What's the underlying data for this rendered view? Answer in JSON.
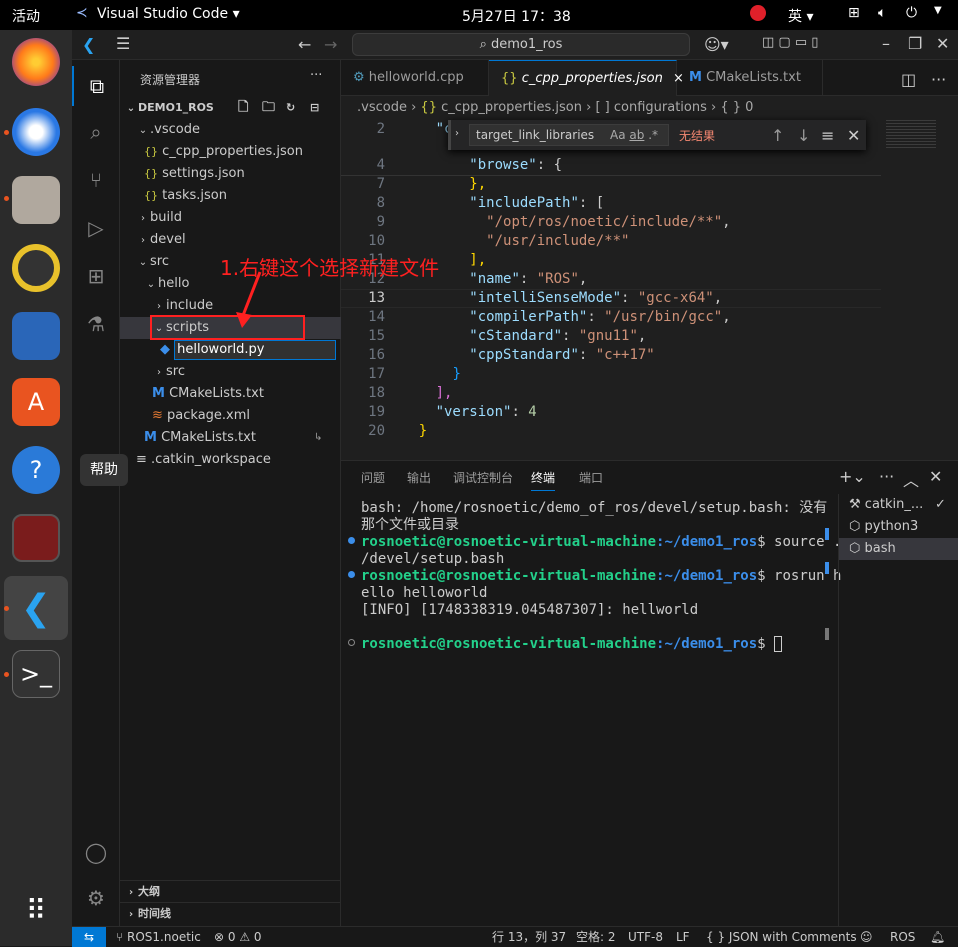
{
  "topbar": {
    "activities": "活动",
    "app_name": "Visual Studio Code",
    "clock": "5月27日  17：38",
    "lang": "英"
  },
  "title": {
    "search": "demo1_ros"
  },
  "dock": {
    "tooltip": "帮助"
  },
  "explorer": {
    "header": "资源管理器",
    "root": "DEMO1_ROS",
    "items": [
      ".vscode",
      "c_cpp_properties.json",
      "settings.json",
      "tasks.json",
      "build",
      "devel",
      "src",
      "hello",
      "include",
      "scripts",
      "helloworld.py",
      "src",
      "CMakeLists.txt",
      "package.xml",
      "CMakeLists.txt",
      ".catkin_workspace"
    ],
    "outline": "大纲",
    "timeline": "时间线"
  },
  "annotation": {
    "text": "1.右键这个选择新建文件",
    "color": "#ff2020"
  },
  "tabs": [
    "helloworld.cpp",
    "c_cpp_properties.json",
    "CMakeLists.txt"
  ],
  "breadcrumb": {
    "p1": ".vscode",
    "p2": "c_cpp_properties.json",
    "p3": "configurations",
    "p4": "0"
  },
  "find": {
    "query": "target_link_libraries",
    "result": "无结果"
  },
  "code": {
    "l2": [
      "2",
      "\"co"
    ],
    "l4": [
      "4",
      "\"browse\"",
      ": {"
    ],
    "l7": [
      "7",
      "},"
    ],
    "l8": [
      "8",
      "\"includePath\"",
      ": ["
    ],
    "l9": [
      "9",
      "\"/opt/ros/noetic/include/**\"",
      ","
    ],
    "l10": [
      "10",
      "\"/usr/include/**\""
    ],
    "l11": [
      "11",
      "],"
    ],
    "l12": [
      "12",
      "\"name\"",
      ": ",
      "\"ROS\"",
      ","
    ],
    "l13": [
      "13",
      "\"intelliSenseMode\"",
      ": ",
      "\"gcc-x64\"",
      ","
    ],
    "l14": [
      "14",
      "\"compilerPath\"",
      ": ",
      "\"/usr/bin/gcc\"",
      ","
    ],
    "l15": [
      "15",
      "\"cStandard\"",
      ": ",
      "\"gnu11\"",
      ","
    ],
    "l16": [
      "16",
      "\"cppStandard\"",
      ": ",
      "\"c++17\""
    ],
    "l17": [
      "17",
      "}"
    ],
    "l18": [
      "18",
      "],"
    ],
    "l19": [
      "19",
      "\"version\"",
      ": ",
      "4"
    ],
    "l20": [
      "20",
      "}"
    ]
  },
  "panel": {
    "tabs": [
      "问题",
      "输出",
      "调试控制台",
      "终端",
      "端口"
    ]
  },
  "terminal": {
    "t1": "bash: /home/rosnoetic/demo_of_ros/devel/setup.bash: 没有",
    "t2": "那个文件或目录",
    "user": "rosnoetic@rosnoetic-virtual-machine",
    "path": ":~/demo1_ros",
    "cmd1": "$ source .",
    "t4": "/devel/setup.bash",
    "cmd2": "$ rosrun h",
    "t6": "ello helloworld",
    "t7": "[INFO] [1748338319.045487307]: hellworld",
    "cmd3": "$ "
  },
  "termlist": [
    "catkin_...",
    "python3",
    "bash"
  ],
  "status": {
    "branch": "ROS1.noetic",
    "errors": "0",
    "warnings": "0",
    "pos": "行 13，列 37",
    "spaces": "空格: 2",
    "enc": "UTF-8",
    "eol": "LF",
    "lang": "JSON with Comments",
    "ros": "ROS"
  }
}
